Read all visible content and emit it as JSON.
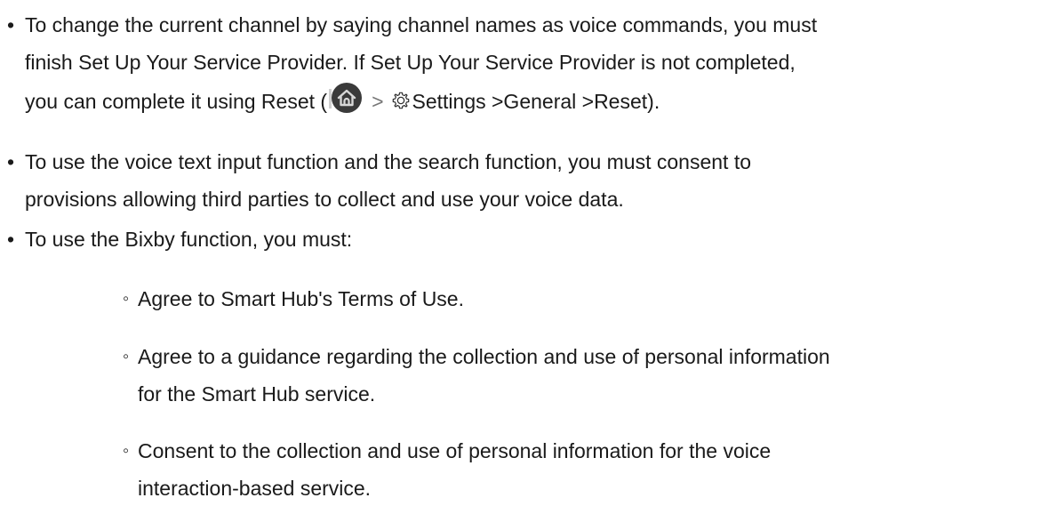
{
  "bullets": [
    {
      "lines": [
        "To change the current channel by saying channel names as voice commands, you must",
        "finish Set Up Your Service Provider. If Set Up Your Service Provider is not completed,"
      ],
      "line3_before": "you can complete it using Reset (",
      "line3_chevron": ">",
      "line3_after": "Settings >General >Reset).",
      "icons": [
        "home-icon",
        "gear-icon"
      ]
    },
    {
      "lines": [
        "To use the voice text input function and the search function, you must consent to",
        "provisions allowing third parties to collect and use your voice data."
      ]
    },
    {
      "lines": [
        "To use the Bixby function, you must:"
      ]
    }
  ],
  "sub_bullets": [
    {
      "lines": [
        "Agree to Smart Hub's Terms of Use."
      ]
    },
    {
      "lines": [
        "Agree to a guidance regarding the collection and use of personal information",
        "for the Smart Hub service."
      ]
    },
    {
      "lines": [
        "Consent to the collection and use of personal information for the voice",
        "interaction-based service."
      ]
    }
  ],
  "bullet_char": "•",
  "sub_bullet_char": "◦",
  "colors": {
    "text": "#1a1a1a",
    "home_icon_dark": "#3a3a3a",
    "home_icon_light": "#d8d8d8"
  }
}
